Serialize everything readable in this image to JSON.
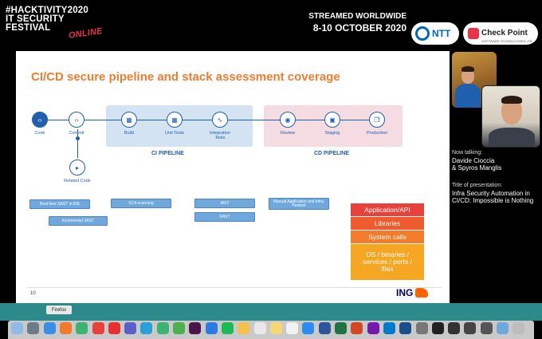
{
  "banner": {
    "event_line1": "#HACKTIVITY2020",
    "event_line2": "IT SECURITY",
    "event_line3": "FESTIVAL",
    "event_online": "ONLINE",
    "streamed": "STREAMED WORLDWIDE",
    "dates": "8-10 OCTOBER 2020",
    "sponsor1": "NTT",
    "sponsor2": "Check Point",
    "sponsor2_sub": "SOFTWARE TECHNOLOGIES LTD"
  },
  "slide": {
    "title": "CI/CD secure pipeline and stack assessment coverage",
    "nodes": [
      {
        "label": "Code",
        "icon": "code-icon"
      },
      {
        "label": "Commit",
        "icon": "commit-icon"
      },
      {
        "label": "Build",
        "icon": "build-icon"
      },
      {
        "label": "Unit Tests",
        "icon": "unit-tests-icon"
      },
      {
        "label": "Integration Tests",
        "icon": "integration-tests-icon"
      },
      {
        "label": "Review",
        "icon": "eye-icon"
      },
      {
        "label": "Staging",
        "icon": "staging-icon"
      },
      {
        "label": "Production",
        "icon": "production-icon"
      }
    ],
    "related": "Related Code",
    "ci_label": "CI PIPELINE",
    "cd_label": "CD PIPELINE",
    "tools": {
      "sast_ide": "Real time SAST in IDE",
      "sast_inc": "Incremental SAST",
      "sca": "SCA scanning",
      "iast": "IAST",
      "dast": "DAST",
      "manual": "Manual Application and Infra. Pentest"
    },
    "stack": [
      {
        "label": "Application/API",
        "color": "#e8413c"
      },
      {
        "label": "Libraries",
        "color": "#ef5a2e"
      },
      {
        "label": "System calls",
        "color": "#f47b2a"
      },
      {
        "label": "OS / binaries / services / ports / files",
        "color": "#f5a623"
      }
    ],
    "page": "10",
    "logo": "ING"
  },
  "panel": {
    "now": "Now talking:",
    "speaker1": "Davide Cioccia",
    "speaker2": "& Spyros Manglis",
    "title_label": "Title of presentation:",
    "presentation": "Infra Security Automation in CI/CD: Impossible is Nothing"
  },
  "dock": {
    "tooltip": "Firefox",
    "apps": [
      "finder-icon",
      "rocket-icon",
      "safari-icon",
      "firefox-icon",
      "chrome-icon",
      "opera-icon",
      "youtube-icon",
      "teams-icon",
      "skype-icon",
      "facetime-icon",
      "messages-icon",
      "slack-icon",
      "vpn-icon",
      "spotify-icon",
      "photos-icon",
      "calendar-icon",
      "notes-icon",
      "reminders-icon",
      "app-store-icon",
      "word-icon",
      "excel-icon",
      "powerpoint-icon",
      "onenote-icon",
      "vscode-icon",
      "virtualbox-icon",
      "utility-icon",
      "terminal-icon",
      "activity-icon",
      "console-icon",
      "scripts-icon",
      "folder-icon",
      "trash-icon"
    ]
  }
}
